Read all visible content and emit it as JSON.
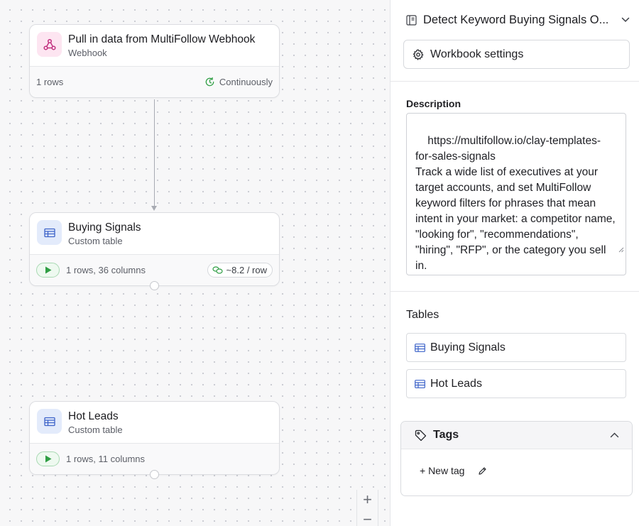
{
  "canvas": {
    "nodes": [
      {
        "title": "Pull in data from MultiFollow Webhook",
        "subtitle": "Webhook",
        "footer_left": "1 rows",
        "footer_right": "Continuously",
        "icon": "webhook-icon"
      },
      {
        "title": "Buying Signals",
        "subtitle": "Custom table",
        "footer_left": "1 rows, 36 columns",
        "cost": "~8.2 / row",
        "icon": "table-icon"
      },
      {
        "title": "Hot Leads",
        "subtitle": "Custom table",
        "footer_left": "1 rows, 11 columns",
        "icon": "table-icon"
      }
    ],
    "zoom": {
      "in_label": "+",
      "out_label": "−"
    }
  },
  "panel": {
    "workbook_title": "Detect Keyword Buying Signals O...",
    "settings_label": "Workbook settings",
    "description_label": "Description",
    "description_text": "https://multifollow.io/clay-templates-for-sales-signals\nTrack a wide list of executives at your target accounts, and set MultiFollow keyword filters for phrases that mean intent in your market: a competitor name, \"looking for\", \"recommendations\", \"hiring\", \"RFP\", or the category you sell in.",
    "tables_label": "Tables",
    "tables": [
      {
        "label": "Buying Signals"
      },
      {
        "label": "Hot Leads"
      }
    ],
    "tags": {
      "label": "Tags",
      "new_tag_label": "+ New tag"
    }
  },
  "colors": {
    "accent_green": "#2f9e44",
    "table_blue": "#3d63c9",
    "webhook_pink": "#c2307f"
  }
}
